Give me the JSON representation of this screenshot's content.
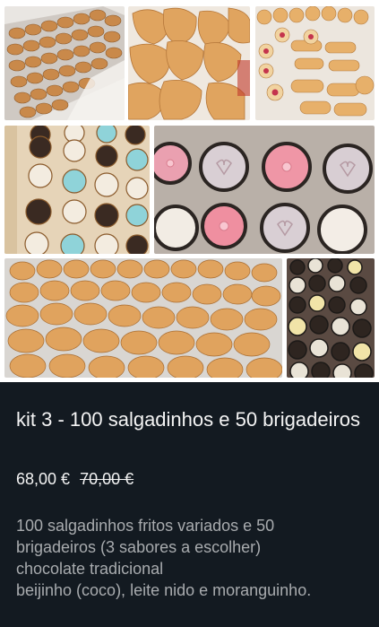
{
  "listing": {
    "title": "kit 3 - 100 salgadinhos e 50 brigadeiros",
    "price": "68,00 €",
    "old_price": "70,00 €",
    "description_lines": [
      "100 salgadinhos fritos variados e 50",
      "brigadeiros (3 sabores a escolher)",
      "chocolate tradicional",
      "beijinho (coco), leite nido e moranguinho."
    ]
  },
  "photos": [
    {
      "name": "photo-fried-croquettes-tray",
      "subject": "fried croquettes in tray"
    },
    {
      "name": "photo-golden-risoles",
      "subject": "golden breaded risoles"
    },
    {
      "name": "photo-assorted-snacks",
      "subject": "assorted fried snacks"
    },
    {
      "name": "photo-brigadeiros-box",
      "subject": "brigadeiros box"
    },
    {
      "name": "photo-decorated-bonbons",
      "subject": "decorated bonbons with hearts and flowers"
    },
    {
      "name": "photo-coxinhas-tray",
      "subject": "fried coxinhas in tray"
    },
    {
      "name": "photo-mini-sweets",
      "subject": "assorted mini sweets"
    }
  ],
  "colors": {
    "panel_bg": "#131a21",
    "title_text": "#f4f4f4",
    "description_text": "#a8abae",
    "fried_gold": "#d9a25a",
    "chocolate": "#3a2a22",
    "pink": "#e98a95"
  }
}
